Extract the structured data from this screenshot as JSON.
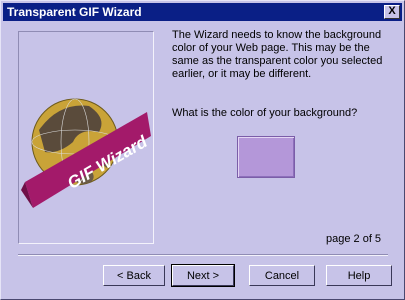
{
  "window": {
    "title": "Transparent GIF Wizard",
    "close_label": "X"
  },
  "graphic": {
    "logo_text": "GIF Wizard"
  },
  "body_text": "The Wizard needs to know the background color of your Web page. This may be the same as the transparent color you selected earlier, or it may be different.",
  "question": "What is the color of your background?",
  "color_swatch": {
    "color": "#b497d9"
  },
  "page_indicator": "page 2 of 5",
  "buttons": {
    "back": "< Back",
    "next": "Next >",
    "cancel": "Cancel",
    "help": "Help"
  }
}
